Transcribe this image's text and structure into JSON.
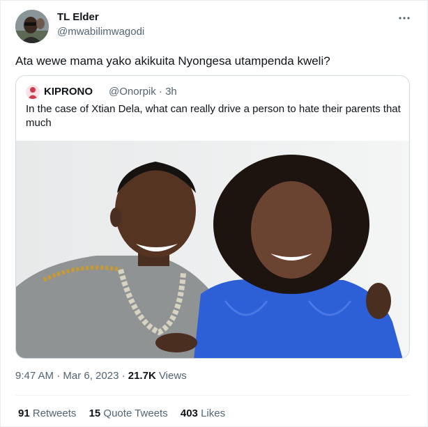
{
  "author": {
    "name": "TL Elder",
    "handle": "@mwabilimwagodi"
  },
  "tweet": {
    "text": "Ata wewe mama yako akikuita Nyongesa utampenda kweli?"
  },
  "quoted_tweet": {
    "name": "KIPRONO",
    "handle_and_time": "@Onorpik · 3h",
    "text": "In the case of Xtian Dela, what can really drive a person to hate their parents that much"
  },
  "meta": {
    "time_date": "9:47 AM · Mar 6, 2023 · ",
    "views_count": "21.7K",
    "views_label": " Views"
  },
  "stats": {
    "retweets_count": "91",
    "retweets_label": "Retweets",
    "quote_tweets_count": "15",
    "quote_tweets_label": "Quote Tweets",
    "likes_count": "403",
    "likes_label": "Likes"
  },
  "icons": {
    "more": "more-icon"
  },
  "colors": {
    "text_primary": "#0f1419",
    "text_secondary": "#536471",
    "border": "#cfd9de",
    "photo_blue_dress": "#2d5fd6"
  }
}
